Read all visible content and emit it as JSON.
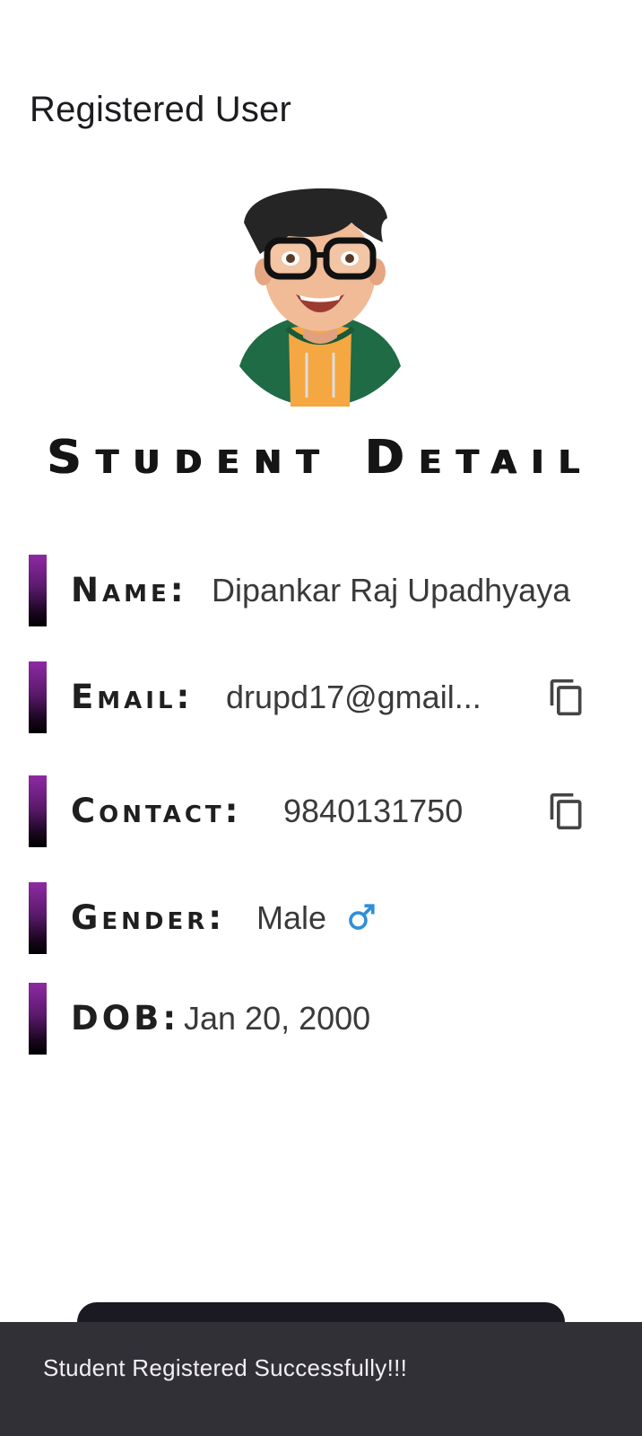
{
  "app_bar": {
    "title": "Registered User"
  },
  "avatar": {
    "icon": "student-avatar-illustration"
  },
  "section": {
    "title": "Student Detail"
  },
  "details": [
    {
      "label": "Name:",
      "value": "Dipankar Raj Upadhyaya"
    },
    {
      "label": "Email:",
      "value": "drupd17@gmail...",
      "action_icon": "copy-icon"
    },
    {
      "label": "Contact:",
      "value": "9840131750",
      "action_icon": "copy-icon"
    },
    {
      "label": "Gender:",
      "value": "Male",
      "icon": "male-symbol-icon"
    },
    {
      "label": "DOB:",
      "value": "Jan 20, 2000"
    }
  ],
  "snackbar": {
    "message": "Student Registered Successfully!!!"
  },
  "colors": {
    "accent_top": "#8e2aa3",
    "accent_bottom": "#000000",
    "gender_icon": "#2f8fd8",
    "snackbar_bg": "#323037",
    "button_bg": "#1b1a22"
  }
}
